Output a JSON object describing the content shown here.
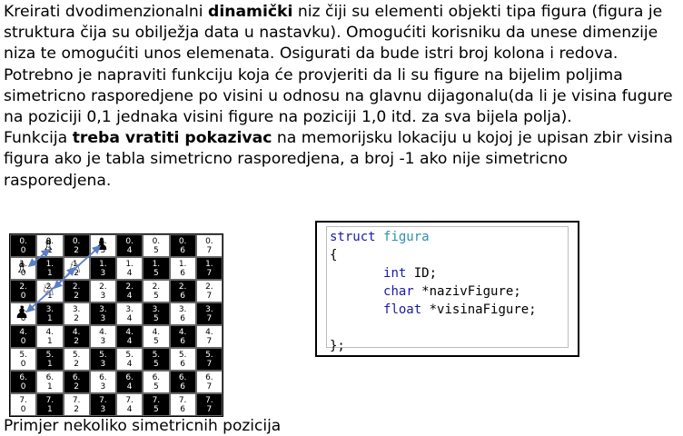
{
  "task": {
    "p1": [
      {
        "text": "Kreirati dvodimenzionalni ",
        "bold": false
      },
      {
        "text": "dinamički",
        "bold": true
      },
      {
        "text": " niz čiji su elementi objekti tipa figura (figura je struktura čija su obilježja data u nastavku). Omogućiti korisniku da unese dimenzije niza te omogućiti unos elemenata. Osigurati da bude istri broj kolona i redova.",
        "bold": false
      }
    ],
    "p2": "Potrebno je napraviti funkciju koja će provjeriti da li su figure na bijelim poljima simetricno rasporedjene po visini u odnosu na glavnu dijagonalu(da li je visina fugure na poziciji 0,1 jednaka visini figure na poziciji 1,0 itd. za sva bijela polja).",
    "p3": [
      {
        "text": "Funkcija ",
        "bold": false
      },
      {
        "text": "treba vratiti pokazivac",
        "bold": true
      },
      {
        "text": " na memorijsku lokaciju u kojoj je upisan zbir visina figura ako je tabla simetricno rasporedjena, a broj -1 ako nije simetricno rasporedjena.",
        "bold": false
      }
    ]
  },
  "board": {
    "size": 8,
    "pieces": [
      {
        "row": 0,
        "col": 1,
        "glyph": "♗",
        "name": "bishop-icon"
      },
      {
        "row": 0,
        "col": 3,
        "glyph": "♟",
        "name": "pawn-icon"
      },
      {
        "row": 1,
        "col": 0,
        "glyph": "♗",
        "name": "bishop-icon"
      },
      {
        "row": 1,
        "col": 2,
        "glyph": "♘",
        "name": "knight-icon"
      },
      {
        "row": 2,
        "col": 1,
        "glyph": "♘",
        "name": "knight-icon"
      },
      {
        "row": 3,
        "col": 0,
        "glyph": "♟",
        "name": "pawn-icon"
      }
    ]
  },
  "caption": "Primjer nekoliko simetricnih pozicija",
  "code": {
    "line1_kw": "struct",
    "line1_type": "figura",
    "line2": "{",
    "fields": [
      {
        "type": "int",
        "name": " ID;"
      },
      {
        "type": "char",
        "name": " *nazivFigure;"
      },
      {
        "type": "float",
        "name": " *visinaFigure;"
      }
    ],
    "end": "};"
  }
}
